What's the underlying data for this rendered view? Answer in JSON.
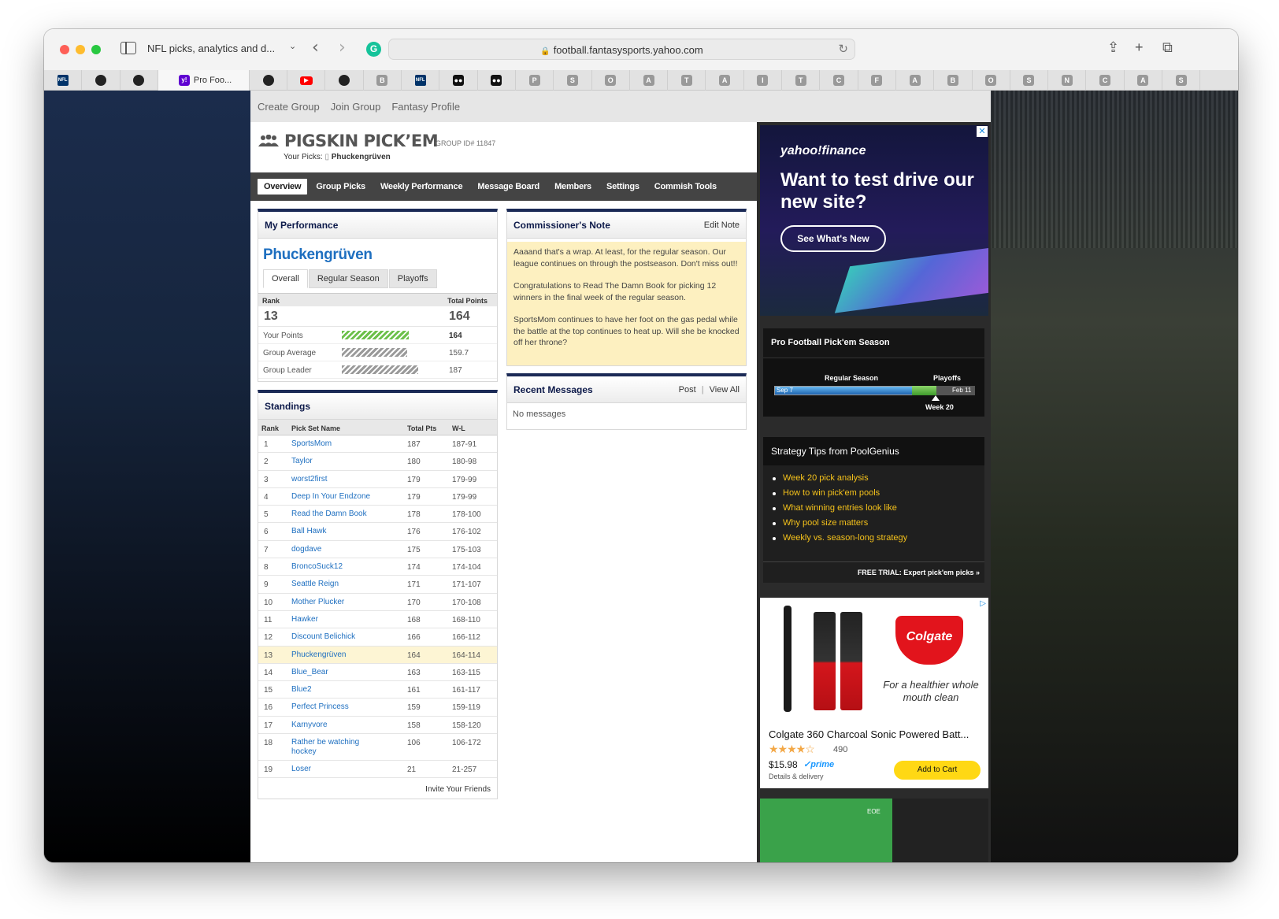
{
  "browser": {
    "tab_title": "NFL picks, analytics and d...",
    "url": "football.fantasysports.yahoo.com",
    "active_tab_label": "Pro Foo...",
    "tabs": [
      {
        "icon": "nfl-icon",
        "glyph": "NFL"
      },
      {
        "icon": "github-icon",
        "glyph": ""
      },
      {
        "icon": "github-icon",
        "glyph": ""
      },
      {
        "icon": "github-icon",
        "glyph": ""
      },
      {
        "icon": "youtube-icon",
        "glyph": "▶"
      },
      {
        "icon": "github-icon",
        "glyph": ""
      },
      {
        "icon": "letter-b-icon",
        "glyph": "B"
      },
      {
        "icon": "nfl-icon",
        "glyph": "NFL"
      },
      {
        "icon": "media-icon",
        "glyph": "●●"
      },
      {
        "icon": "media-icon",
        "glyph": "●●"
      },
      {
        "icon": "letter-p-icon",
        "glyph": "P"
      },
      {
        "icon": "letter-s-icon",
        "glyph": "S"
      },
      {
        "icon": "letter-o-icon",
        "glyph": "O"
      },
      {
        "icon": "letter-a-icon",
        "glyph": "A"
      },
      {
        "icon": "letter-t-icon",
        "glyph": "T"
      },
      {
        "icon": "letter-a-icon",
        "glyph": "A"
      },
      {
        "icon": "letter-i-icon",
        "glyph": "I"
      },
      {
        "icon": "letter-t-icon",
        "glyph": "T"
      },
      {
        "icon": "letter-c-icon",
        "glyph": "C"
      },
      {
        "icon": "letter-f-icon",
        "glyph": "F"
      },
      {
        "icon": "letter-a-icon",
        "glyph": "A"
      },
      {
        "icon": "letter-b-icon",
        "glyph": "B"
      },
      {
        "icon": "letter-o-icon",
        "glyph": "O"
      },
      {
        "icon": "letter-s-icon",
        "glyph": "S"
      },
      {
        "icon": "letter-n-icon",
        "glyph": "N"
      },
      {
        "icon": "letter-c-icon",
        "glyph": "C"
      },
      {
        "icon": "letter-a-icon",
        "glyph": "A"
      },
      {
        "icon": "letter-s-icon",
        "glyph": "S"
      }
    ]
  },
  "topnav": {
    "create_group": "Create Group",
    "join_group": "Join Group",
    "fantasy_profile": "Fantasy Profile"
  },
  "brand": {
    "title": "PIGSKIN PICK’EM",
    "group_id": "GROUP ID# 11847",
    "your_picks_label": "Your Picks:",
    "your_picks_name": "Phuckengrüven"
  },
  "mainnav": [
    "Overview",
    "Group Picks",
    "Weekly Performance",
    "Message Board",
    "Members",
    "Settings",
    "Commish Tools"
  ],
  "performance": {
    "title": "My Performance",
    "name": "Phuckengrüven",
    "tabs": [
      "Overall",
      "Regular Season",
      "Playoffs"
    ],
    "rank_label": "Rank",
    "total_points_label": "Total Points",
    "rank": "13",
    "total_points": "164",
    "rows": [
      {
        "label": "Your Points",
        "value": "164",
        "bar_fraction": 0.877
      },
      {
        "label": "Group Average",
        "value": "159.7",
        "bar_fraction": 0.854
      },
      {
        "label": "Group Leader",
        "value": "187",
        "bar_fraction": 1.0
      }
    ],
    "colors": {
      "your_bar": "#6cc04a",
      "other_bar": "#9a9a9a"
    }
  },
  "standings": {
    "title": "Standings",
    "headers": {
      "rank": "Rank",
      "name": "Pick Set Name",
      "pts": "Total Pts",
      "wl": "W-L"
    },
    "rows": [
      {
        "rank": "1",
        "name": "SportsMom",
        "pts": "187",
        "wl": "187-91"
      },
      {
        "rank": "2",
        "name": "Taylor",
        "pts": "180",
        "wl": "180-98"
      },
      {
        "rank": "3",
        "name": "worst2first",
        "pts": "179",
        "wl": "179-99"
      },
      {
        "rank": "4",
        "name": "Deep In Your Endzone",
        "pts": "179",
        "wl": "179-99"
      },
      {
        "rank": "5",
        "name": "Read the Damn Book",
        "pts": "178",
        "wl": "178-100"
      },
      {
        "rank": "6",
        "name": "Ball Hawk",
        "pts": "176",
        "wl": "176-102"
      },
      {
        "rank": "7",
        "name": "dogdave",
        "pts": "175",
        "wl": "175-103"
      },
      {
        "rank": "8",
        "name": "BroncoSuck12",
        "pts": "174",
        "wl": "174-104"
      },
      {
        "rank": "9",
        "name": "Seattle Reign",
        "pts": "171",
        "wl": "171-107"
      },
      {
        "rank": "10",
        "name": "Mother Plucker",
        "pts": "170",
        "wl": "170-108"
      },
      {
        "rank": "11",
        "name": "Hawker",
        "pts": "168",
        "wl": "168-110"
      },
      {
        "rank": "12",
        "name": "Discount Belichick",
        "pts": "166",
        "wl": "166-112"
      },
      {
        "rank": "13",
        "name": "Phuckengrüven",
        "pts": "164",
        "wl": "164-114"
      },
      {
        "rank": "14",
        "name": "Blue_Bear",
        "pts": "163",
        "wl": "163-115"
      },
      {
        "rank": "15",
        "name": "Blue2",
        "pts": "161",
        "wl": "161-117"
      },
      {
        "rank": "16",
        "name": "Perfect Princess",
        "pts": "159",
        "wl": "159-119"
      },
      {
        "rank": "17",
        "name": "Karnyvore",
        "pts": "158",
        "wl": "158-120"
      },
      {
        "rank": "18",
        "name": "Rather be watching hockey",
        "pts": "106",
        "wl": "106-172"
      },
      {
        "rank": "19",
        "name": "Loser",
        "pts": "21",
        "wl": "21-257"
      }
    ],
    "invite": "Invite Your Friends"
  },
  "commissioner": {
    "title": "Commissioner's Note",
    "edit": "Edit Note",
    "paragraphs": [
      "Aaaand that's a wrap. At least, for the regular season. Our league continues on through the postseason. Don't miss out!!",
      "Congratulations to Read The Damn Book for picking 12 winners in the final week of the regular season.",
      "SportsMom continues to have her foot on the gas pedal while the battle at the top continues to heat up. Will she be knocked off her throne?"
    ]
  },
  "recent": {
    "title": "Recent Messages",
    "post": "Post",
    "view_all": "View All",
    "empty": "No messages"
  },
  "ads": {
    "yahoo_finance": {
      "logo": "yahoo!finance",
      "headline": "Want to test drive our new site?",
      "cta": "See What's New"
    },
    "amazon": {
      "brand": "Colgate",
      "tagline": "For a healthier whole mouth clean",
      "title": "Colgate 360 Charcoal Sonic Powered Batt...",
      "stars": "★★★★☆",
      "reviews": "490",
      "price": "$15.98",
      "prime": "✓prime",
      "delivery": "Details & delivery",
      "cart": "Add to Cart"
    },
    "eoe": "EOE"
  },
  "season": {
    "title": "Pro Football Pick'em Season",
    "regular_label": "Regular Season",
    "playoffs_label": "Playoffs",
    "start": "Sep 7",
    "end": "Feb 11",
    "week": "Week 20"
  },
  "tips": {
    "title": "Strategy Tips from PoolGenius",
    "items": [
      "Week 20 pick analysis",
      "How to win pick'em pools",
      "What winning entries look like",
      "Why pool size matters",
      "Weekly vs. season-long strategy"
    ],
    "footer": "FREE TRIAL: Expert pick'em picks »"
  }
}
